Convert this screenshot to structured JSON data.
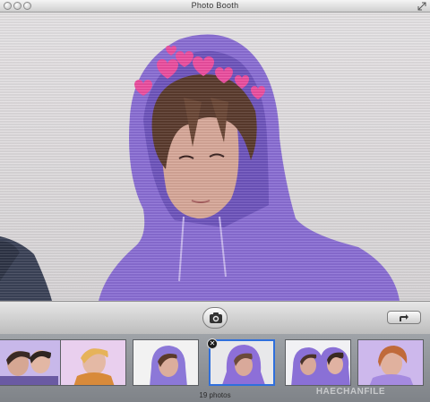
{
  "window": {
    "title": "Photo Booth"
  },
  "preview": {
    "effect": "hearts-crown",
    "hoodie_color": "#8b6fd6"
  },
  "toolbar": {
    "shutter_icon": "camera-icon",
    "share_icon": "share-arrow-icon"
  },
  "filmstrip": {
    "count_label": "19 photos",
    "watermark": "HAECHANFILE",
    "thumbnails": [
      {
        "bg": "#c8b8ea",
        "shirt": "#6a5aa3",
        "hair": "#3a2a24"
      },
      {
        "bg": "#e9cfee",
        "shirt": "#d88a3a",
        "hair": "#e6b35a"
      },
      {
        "bg": "#f2f2f2",
        "shirt": "#8c78d8",
        "hair": "#5a3a2a"
      },
      {
        "bg": "#e8e8ea",
        "shirt": "#8d6fd8",
        "hair": "#6b4a3a"
      },
      {
        "bg": "#f1f1f4",
        "shirt": "#8a70d6",
        "hair": "#4a3328"
      },
      {
        "bg": "#cdb8ec",
        "shirt": "#a58ae0",
        "hair": "#c06a3a"
      }
    ],
    "selected_index": 3
  }
}
